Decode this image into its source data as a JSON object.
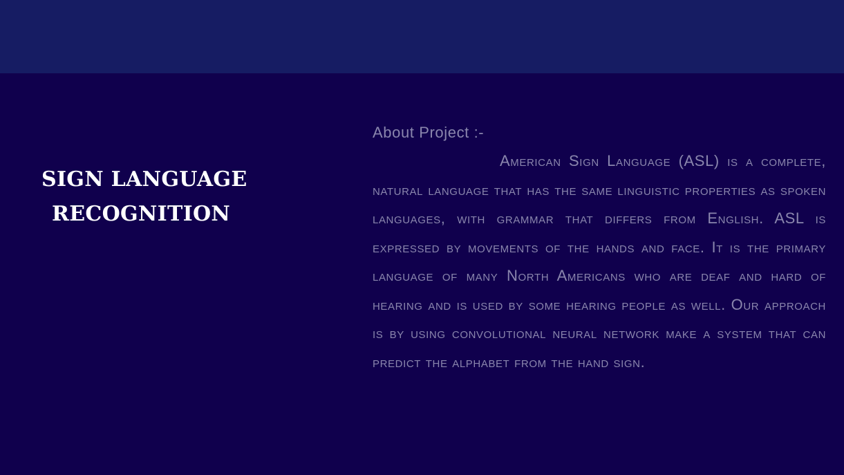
{
  "title": {
    "line1": "SIGN LANGUAGE",
    "line2": "RECOGNITION"
  },
  "about": {
    "heading": "About Project :-",
    "body": "American Sign Language (ASL) is a complete, natural language that has the same linguistic properties as spoken languages, with grammar that differs from English. ASL is expressed by movements of the hands and face. It is the primary language of many North Americans who are deaf and hard of hearing and is used by some hearing people as well. Our approach is by using convolutional neural network make a system that can predict the alphabet from the hand sign."
  },
  "colors": {
    "top_banner": "#161c63",
    "background": "#10004d",
    "title_text": "#ffffff",
    "body_text": "#8a86ad"
  }
}
